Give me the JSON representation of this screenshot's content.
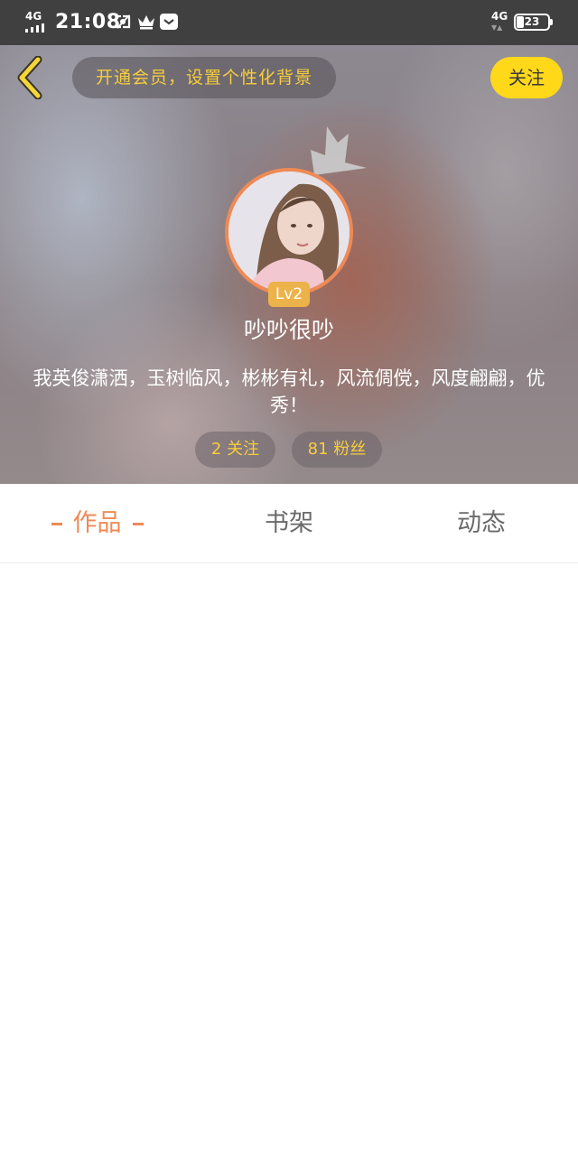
{
  "status_bar": {
    "network_left": "4G",
    "time": "21:08",
    "network_right": "4G",
    "battery_level": "23",
    "icons": [
      "screenshot-icon",
      "crown-icon",
      "mail-icon"
    ]
  },
  "header": {
    "back_icon": "chevron-left-icon",
    "vip_prompt": "开通会员，设置个性化背景",
    "follow_label": "关注",
    "level": "Lv2",
    "username": "吵吵很吵",
    "bio": "我英俊潇洒，玉树临风，彬彬有礼，风流倜傥，风度翩翩，优秀！",
    "following": "2 关注",
    "fans": "81 粉丝"
  },
  "tabs": [
    {
      "label": "作品",
      "active": true
    },
    {
      "label": "书架",
      "active": false
    },
    {
      "label": "动态",
      "active": false
    }
  ],
  "colors": {
    "accent": "#ef8a56",
    "gold": "#f6cd3c",
    "follow_button": "#ffd81a",
    "status_bar": "#404040"
  }
}
